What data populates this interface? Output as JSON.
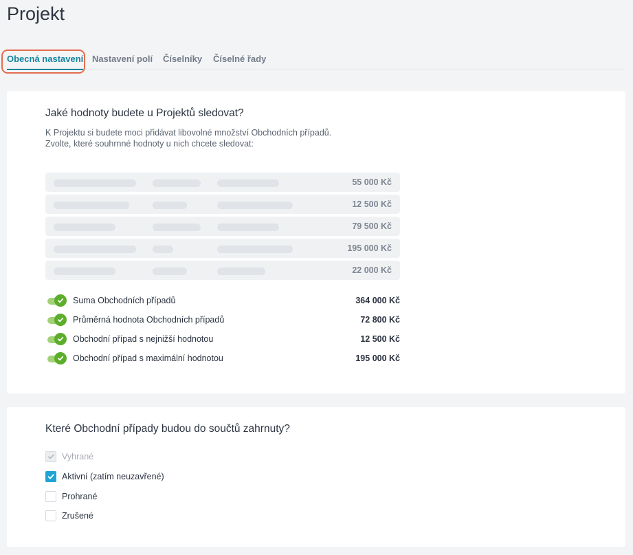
{
  "page": {
    "title": "Projekt"
  },
  "tabs": [
    {
      "label": "Obecná nastavení",
      "active": true
    },
    {
      "label": "Nastavení polí",
      "active": false
    },
    {
      "label": "Číselníky",
      "active": false
    },
    {
      "label": "Číselné řady",
      "active": false
    }
  ],
  "values_section": {
    "heading": "Jaké hodnoty budete u Projektů sledovat?",
    "description_line1": "K Projektu si budete moci přidávat libovolné množství Obchodních případů.",
    "description_line2": "Zvolte, které souhrnné hodnoty u nich chcete sledovat:",
    "preview_values": [
      "55 000 Kč",
      "12 500 Kč",
      "79 500 Kč",
      "195 000 Kč",
      "22 000 Kč"
    ],
    "metrics": [
      {
        "label": "Suma Obchodních případů",
        "value": "364 000 Kč",
        "enabled": true
      },
      {
        "label": "Průměrná hodnota Obchodních případů",
        "value": "72 800 Kč",
        "enabled": true
      },
      {
        "label": "Obchodní případ s nejnižší hodnotou",
        "value": "12 500 Kč",
        "enabled": true
      },
      {
        "label": "Obchodní případ s maximální hodnotou",
        "value": "195 000 Kč",
        "enabled": true
      }
    ]
  },
  "included_section": {
    "heading": "Které Obchodní případy budou do součtů zahrnuty?",
    "options": [
      {
        "label": "Vyhrané",
        "checked": true,
        "disabled": true
      },
      {
        "label": "Aktivní (zatím neuzavřené)",
        "checked": true,
        "disabled": false
      },
      {
        "label": "Prohrané",
        "checked": false,
        "disabled": false
      },
      {
        "label": "Zrušené",
        "checked": false,
        "disabled": false
      }
    ]
  },
  "colors": {
    "accent": "#17849c",
    "toggle_on": "#5cae2a",
    "checkbox_checked": "#1fa4d6",
    "highlight": "#e56c4d"
  }
}
